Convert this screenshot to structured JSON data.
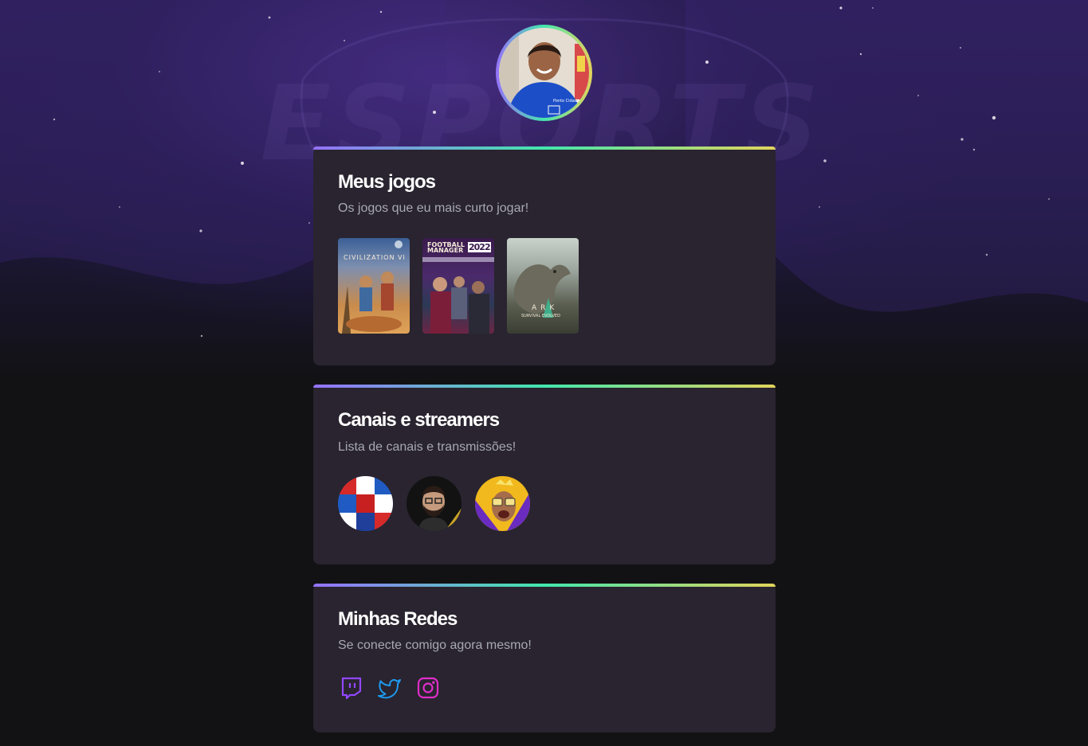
{
  "profile": {
    "avatar_icon": "profile-photo"
  },
  "background": {
    "watermark": "ESPORTS"
  },
  "games_card": {
    "title": "Meus jogos",
    "subtitle": "Os jogos que eu mais curto jogar!",
    "games": [
      {
        "cover_text": "CIVILIZATION VI"
      },
      {
        "cover_text_1": "FOOTBALL",
        "cover_text_2": "MANAGER",
        "cover_year": "2022"
      },
      {
        "cover_text": "ARK",
        "cover_subtext": "SURVIVAL EVOLVED"
      }
    ]
  },
  "streamers_card": {
    "title": "Canais e streamers",
    "subtitle": "Lista de canais e transmissões!",
    "streamers": [
      {
        "icon": "jerseys-avatar"
      },
      {
        "icon": "bearded-man-avatar"
      },
      {
        "icon": "sunglasses-man-avatar"
      }
    ]
  },
  "socials_card": {
    "title": "Minhas Redes",
    "subtitle": "Se conecte comigo agora mesmo!",
    "links": [
      {
        "icon": "twitch-icon",
        "color": "#9147ff"
      },
      {
        "icon": "twitter-icon",
        "color": "#1d9bf0"
      },
      {
        "icon": "instagram-icon",
        "color": "#e02ec9"
      }
    ]
  },
  "colors": {
    "card_bg": "#29242f",
    "page_bg": "#121214",
    "gradient": [
      "#9572fc",
      "#43e7ad",
      "#e2d45c"
    ],
    "subtitle": "#a8a8b3"
  }
}
